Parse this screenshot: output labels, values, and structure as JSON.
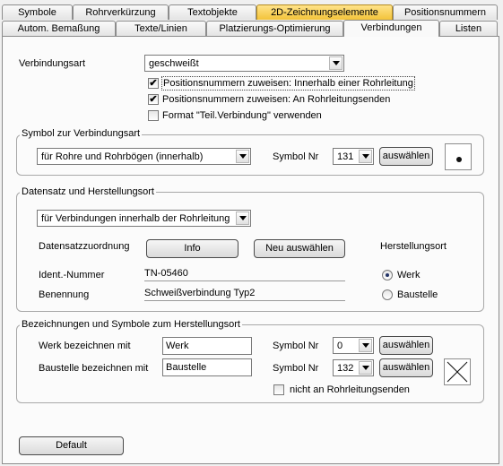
{
  "tabs_row1": [
    "Symbole",
    "Rohrverkürzung",
    "Textobjekte",
    "2D-Zeichnungselemente",
    "Positionsnummern"
  ],
  "tabs_row2": [
    "Autom. Bemaßung",
    "Texte/Linien",
    "Platzierungs-Optimierung",
    "Verbindungen",
    "Listen"
  ],
  "verbindungsart": {
    "label": "Verbindungsart",
    "value": "geschweißt"
  },
  "checkboxes": [
    {
      "label": "Positionsnummern zuweisen: Innerhalb einer Rohrleitung",
      "checked": true
    },
    {
      "label": "Positionsnummern zuweisen: An Rohrleitungsenden",
      "checked": true
    },
    {
      "label": "Format \"Teil.Verbindung\" verwenden",
      "checked": false
    }
  ],
  "symbol_group": {
    "title": "Symbol zur Verbindungsart",
    "select_value": "für Rohre und Rohrbögen (innerhalb)",
    "symbol_label": "Symbol Nr",
    "symbol_value": "131",
    "choose_label": "auswählen"
  },
  "datensatz_group": {
    "title": "Datensatz und Herstellungsort",
    "select_value": "für Verbindungen innerhalb der Rohrleitung",
    "zuordnung_label": "Datensatzzuordnung",
    "info_label": "Info",
    "new_label": "Neu auswählen",
    "herstellungsort_label": "Herstellungsort",
    "ident_label": "Ident.-Nummer",
    "ident_value": "TN-05460",
    "benennung_label": "Benennung",
    "benennung_value": "Schweißverbindung Typ2",
    "radio_werk": "Werk",
    "radio_baustelle": "Baustelle",
    "selected_radio": "Werk"
  },
  "bezeichnung_group": {
    "title": "Bezeichnungen und Symbole zum Herstellungsort",
    "werk_label": "Werk bezeichnen mit",
    "werk_value": "Werk",
    "werk_symbol_label": "Symbol Nr",
    "werk_symbol_value": "0",
    "baustelle_label": "Baustelle bezeichnen mit",
    "baustelle_value": "Baustelle",
    "baustelle_symbol_label": "Symbol Nr",
    "baustelle_symbol_value": "132",
    "choose_label": "auswählen",
    "nicht_label": "nicht an Rohrleitungsenden"
  },
  "default_button": "Default",
  "colors": {
    "highlight_tab": "#f3c33a",
    "panel_bg": "#fbfbfb"
  }
}
